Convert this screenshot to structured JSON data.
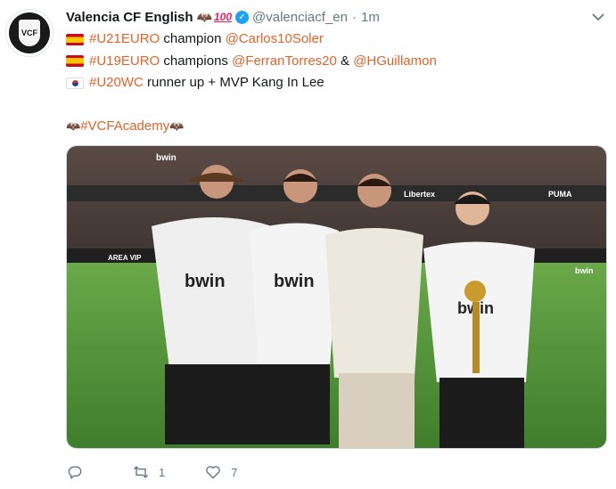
{
  "tweet": {
    "author_name": "Valencia CF English",
    "author_emoji_bat": "🦇",
    "author_emoji_100": "100",
    "handle": "@valenciacf_en",
    "separator": "·",
    "time": "1m",
    "lines": [
      {
        "flag": "es",
        "hashtag": "#U21EURO",
        "text1": " champion ",
        "mention1": "@Carlos10Soler",
        "text2": "",
        "mention2": ""
      },
      {
        "flag": "es",
        "hashtag": "#U19EURO",
        "text1": " champions ",
        "mention1": "@FerranTorres20",
        "text2": " & ",
        "mention2": "@HGuillamon"
      },
      {
        "flag": "kr",
        "hashtag": "#U20WC",
        "text1": " runner up + MVP Kang In Lee",
        "mention1": "",
        "text2": "",
        "mention2": ""
      }
    ],
    "footer_hashtag": "#VCFAcademy",
    "footer_bat": "🦇",
    "retweet_count": "1",
    "like_count": "7"
  },
  "photo": {
    "banner_texts": [
      "bwin",
      "Libertex",
      "PUMA",
      "AREA VIP",
      "bwin"
    ],
    "shirt_sponsor": "bwin",
    "players": 4
  },
  "icons": {
    "chevron": "chevron-down-icon",
    "reply": "reply-icon",
    "retweet": "retweet-icon",
    "like": "heart-icon",
    "verified": "verified-badge-icon"
  },
  "colors": {
    "link": "#e0632b",
    "verified": "#1da1f2",
    "muted": "#657786"
  }
}
